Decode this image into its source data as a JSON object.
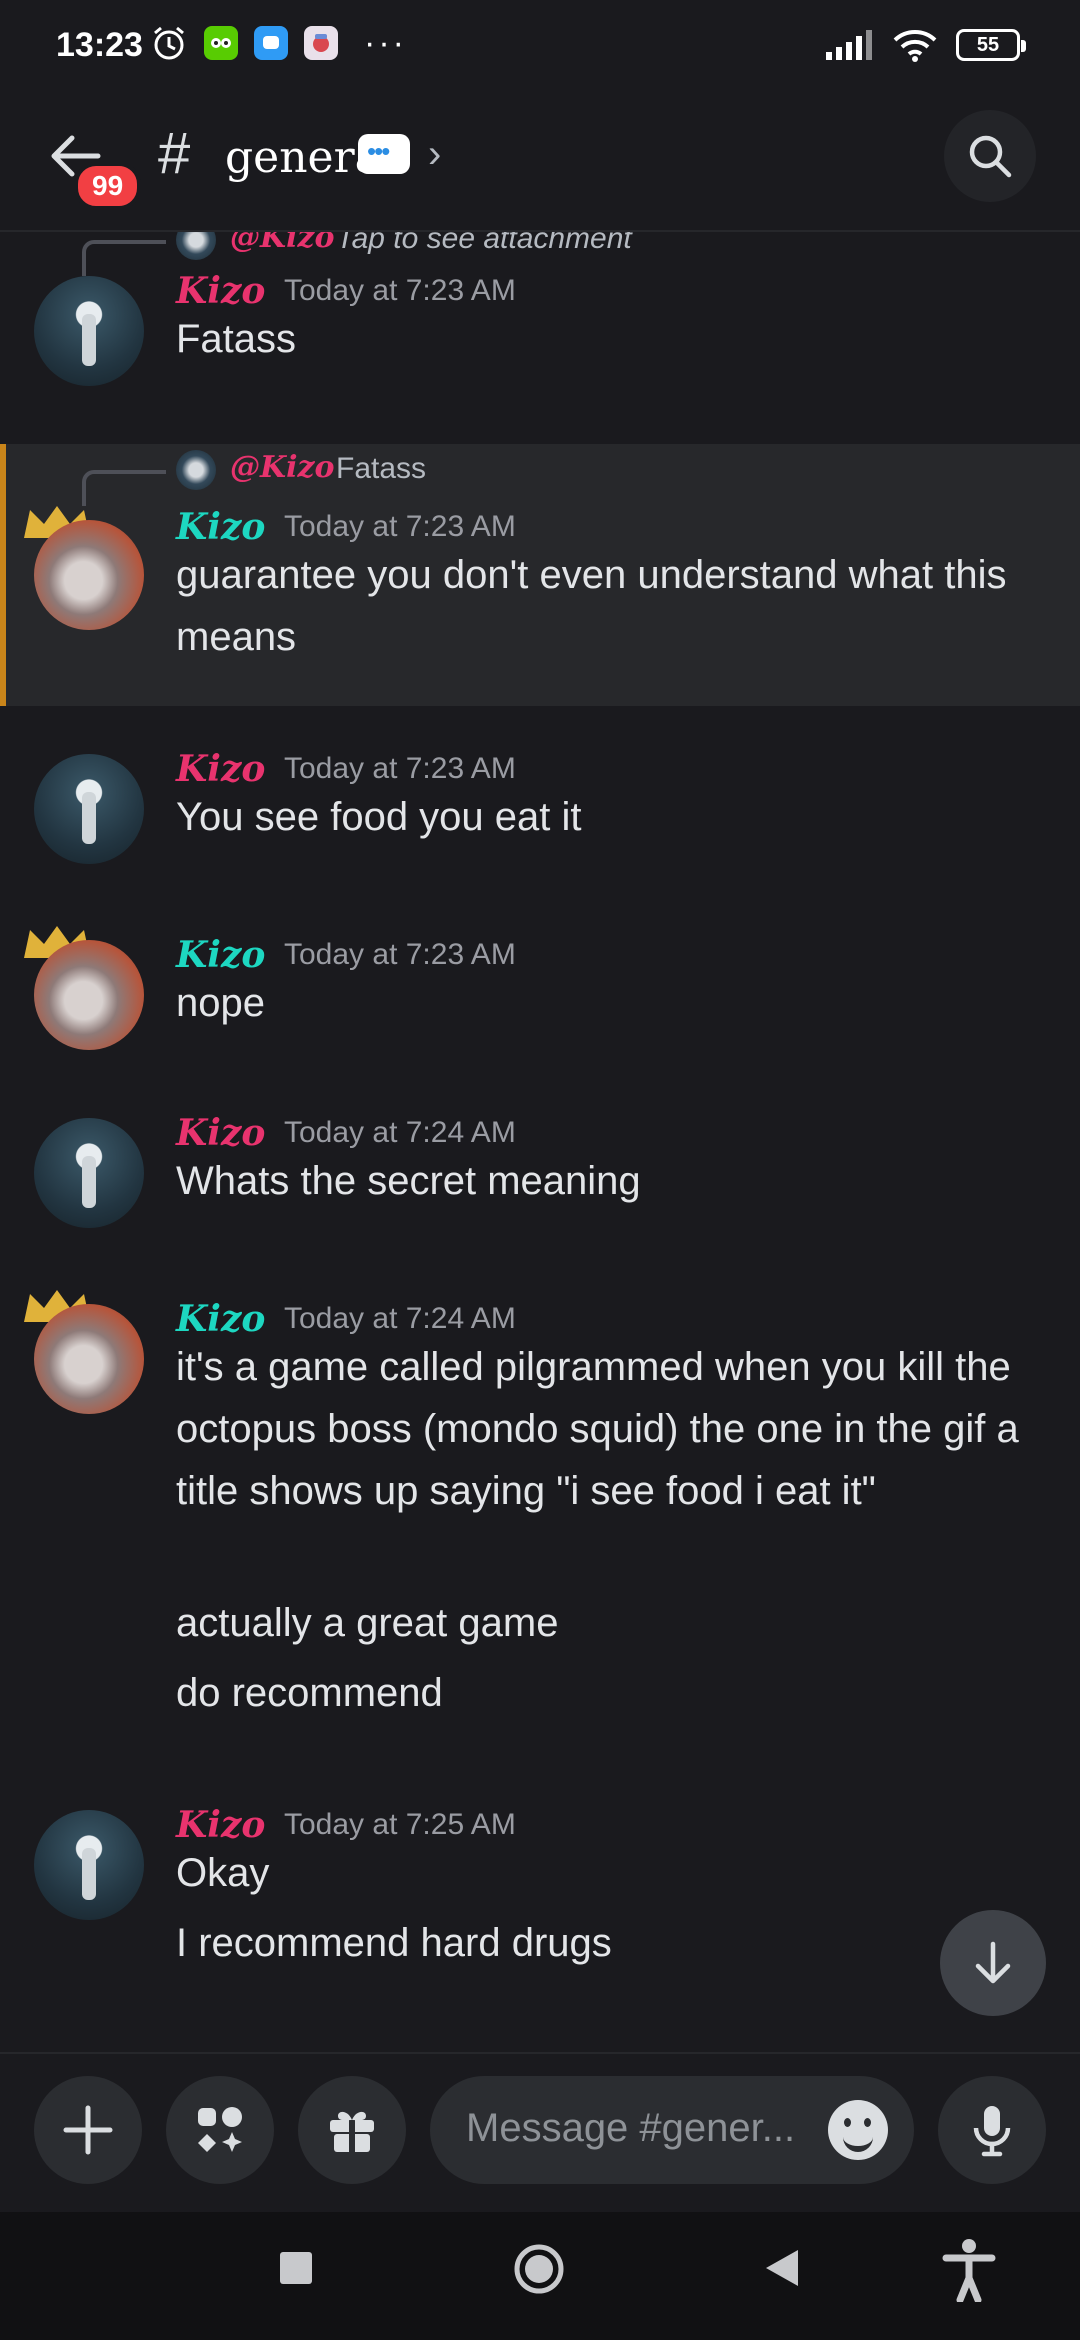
{
  "status_bar": {
    "time": "13:23",
    "battery": "55",
    "more": "···"
  },
  "header": {
    "unread_badge": "99",
    "hash": "#",
    "channel_name": "general"
  },
  "messages": [
    {
      "id": "m1",
      "author": "Kizo",
      "author_color": "#e8336e",
      "avatar": "av-a",
      "timestamp": "Today at 7:23 AM",
      "lines": [
        "Fatass"
      ]
    },
    {
      "id": "m2",
      "author": "Kizo",
      "author_color": "#1dd7c1",
      "avatar": "av-b",
      "timestamp": "Today at 7:23 AM",
      "reply_to": {
        "author": "@Kizo",
        "text": "Fatass"
      },
      "highlighted": true,
      "lines": [
        "guarantee you don't even understand what this means"
      ]
    },
    {
      "id": "m3",
      "author": "Kizo",
      "author_color": "#e8336e",
      "avatar": "av-a",
      "timestamp": "Today at 7:23 AM",
      "lines": [
        "You see food you eat it"
      ]
    },
    {
      "id": "m4",
      "author": "Kizo",
      "author_color": "#1dd7c1",
      "avatar": "av-b",
      "timestamp": "Today at 7:23 AM",
      "lines": [
        "nope"
      ]
    },
    {
      "id": "m5",
      "author": "Kizo",
      "author_color": "#e8336e",
      "avatar": "av-a",
      "timestamp": "Today at 7:24 AM",
      "lines": [
        "Whats the secret meaning"
      ]
    },
    {
      "id": "m6",
      "author": "Kizo",
      "author_color": "#1dd7c1",
      "avatar": "av-b",
      "timestamp": "Today at 7:24 AM",
      "lines": [
        "it's a game called pilgrammed when you kill the octopus boss (mondo squid) the one in the gif a title shows up saying \"i see food i eat it\"",
        "actually a great game",
        "do recommend"
      ]
    },
    {
      "id": "m7",
      "author": "Kizo",
      "author_color": "#e8336e",
      "avatar": "av-a",
      "timestamp": "Today at 7:25 AM",
      "lines": [
        "Okay",
        "I recommend hard drugs"
      ]
    }
  ],
  "top_partial_reply": {
    "author": "@Kizo",
    "text": "Tap to see attachment"
  },
  "composer": {
    "placeholder": "Message #gener..."
  },
  "colors": {
    "background": "#1a1a1e",
    "badge": "#f23f43",
    "pink_name": "#e8336e",
    "teal_name": "#1dd7c1",
    "highlight_bar": "#c9851a"
  }
}
